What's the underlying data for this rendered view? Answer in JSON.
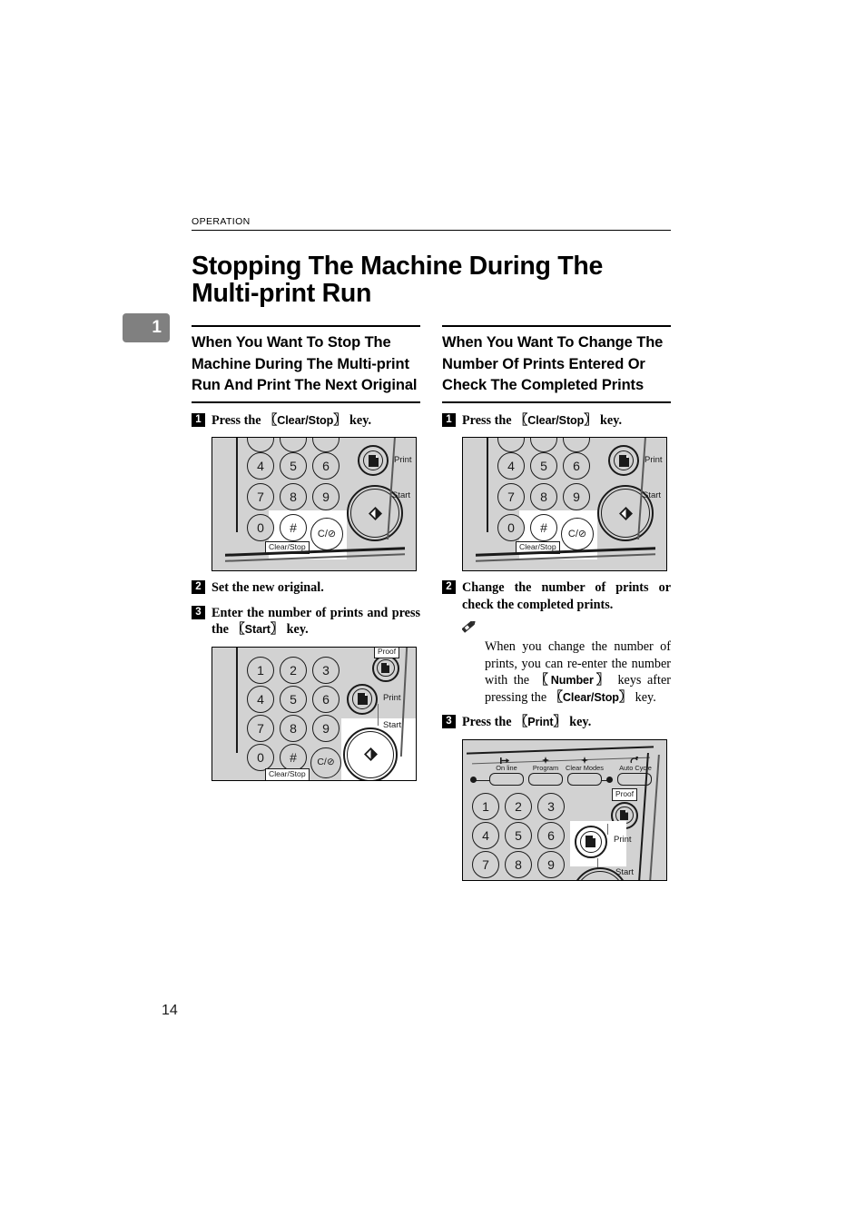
{
  "running_head": "OPERATION",
  "chapter_tab": "1",
  "page_number": "14",
  "doc_title": "Stopping The Machine During The Multi-print Run",
  "left_column": {
    "section_title": "When You Want To Stop The Machine During The Multi-print Run And Print The Next Original",
    "steps": [
      {
        "num": "1",
        "text_before": "Press the ",
        "key": "Clear/Stop",
        "text_after": " key."
      },
      {
        "num": "2",
        "text_before": "Set the new original.",
        "key": "",
        "text_after": ""
      },
      {
        "num": "3",
        "text_before": "Enter the number of prints and press the ",
        "key": "Start",
        "text_after": " key."
      }
    ]
  },
  "right_column": {
    "section_title": "When You Want To Change The Number Of Prints Entered Or Check The Completed Prints",
    "steps": [
      {
        "num": "1",
        "text_before": "Press the ",
        "key": "Clear/Stop",
        "text_after": " key."
      },
      {
        "num": "2",
        "text_before": "Change the number of prints or check the completed prints.",
        "key": "",
        "text_after": ""
      },
      {
        "num": "3",
        "text_before": "Press the ",
        "key": "Print",
        "text_after": " key."
      }
    ],
    "note": {
      "icon": "pencil-icon",
      "part1": "When you change the number of prints, you can re-enter the number with the ",
      "key1": "Number",
      "part2": " keys after pressing the ",
      "key2": "Clear/Stop",
      "part3": " key."
    }
  },
  "figures": {
    "fig1": {
      "caption": "operator-panel-clear-stop-highlighted",
      "keys": [
        "4",
        "5",
        "6",
        "7",
        "8",
        "9",
        "0",
        "#"
      ],
      "clear_stop_glyph": "C/⊘",
      "clear_stop_label": "Clear/Stop",
      "print_label": "Print",
      "start_label": "Start",
      "highlighted": "Clear/Stop"
    },
    "fig2": {
      "caption": "operator-panel-start-highlighted",
      "keys": [
        "1",
        "2",
        "3",
        "4",
        "5",
        "6",
        "7",
        "8",
        "9",
        "0",
        "#"
      ],
      "clear_stop_glyph": "C/⊘",
      "clear_stop_label": "Clear/Stop",
      "proof_label": "Proof",
      "print_label": "Print",
      "start_label": "Start",
      "highlighted": "Start"
    },
    "fig3": {
      "caption": "operator-panel-print-highlighted",
      "keys": [
        "1",
        "2",
        "3",
        "4",
        "5",
        "6",
        "7",
        "8",
        "9"
      ],
      "function_buttons": [
        "On line",
        "Program",
        "Clear Modes",
        "Auto Cycle"
      ],
      "proof_label": "Proof",
      "print_label": "Print",
      "start_label": "Start",
      "highlighted": "Print"
    },
    "fig4": {
      "caption": "operator-panel-clear-stop-highlighted-right",
      "keys": [
        "4",
        "5",
        "6",
        "7",
        "8",
        "9",
        "0",
        "#"
      ],
      "clear_stop_glyph": "C/⊘",
      "clear_stop_label": "Clear/Stop",
      "print_label": "Print",
      "start_label": "Start",
      "highlighted": "Clear/Stop"
    }
  },
  "colors": {
    "panel_gray": "#d2d2d2",
    "chapter_tab": "#808080",
    "ink": "#000000"
  }
}
